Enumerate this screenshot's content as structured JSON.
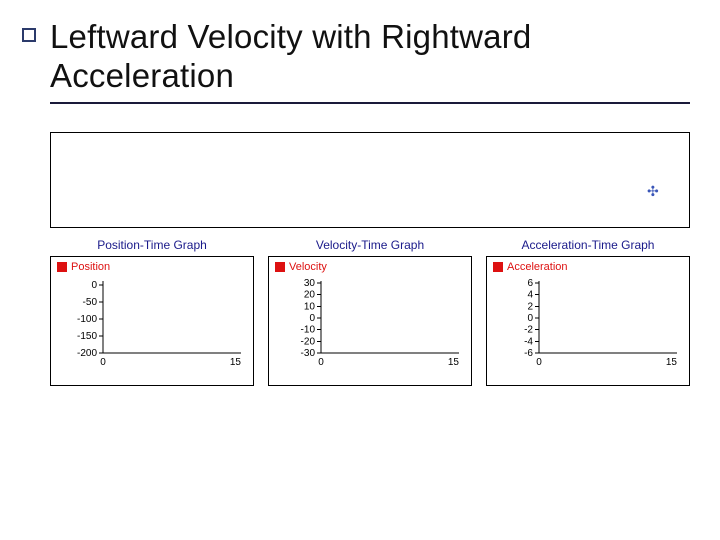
{
  "title": "Leftward Velocity with Rightward Acceleration",
  "anim_marker_glyph": "✣",
  "charts": [
    {
      "title": "Position-Time Graph",
      "legend": "Position",
      "y_ticks": [
        "0",
        "-50",
        "-100",
        "-150",
        "-200"
      ],
      "x_ticks": [
        "0",
        "15"
      ]
    },
    {
      "title": "Velocity-Time Graph",
      "legend": "Velocity",
      "y_ticks": [
        "30",
        "20",
        "10",
        "0",
        "-10",
        "-20",
        "-30"
      ],
      "x_ticks": [
        "0",
        "15"
      ]
    },
    {
      "title": "Acceleration-Time Graph",
      "legend": "Acceleration",
      "y_ticks": [
        "6",
        "4",
        "2",
        "0",
        "-2",
        "-4",
        "-6"
      ],
      "x_ticks": [
        "0",
        "15"
      ]
    }
  ],
  "chart_data": [
    {
      "type": "line",
      "title": "Position-Time Graph",
      "xlabel": "",
      "ylabel": "Position",
      "xlim": [
        0,
        15
      ],
      "ylim": [
        -200,
        0
      ],
      "x": [],
      "values": [],
      "series_name": "Position",
      "note": "empty plot area (no data curve drawn in frame)"
    },
    {
      "type": "line",
      "title": "Velocity-Time Graph",
      "xlabel": "",
      "ylabel": "Velocity",
      "xlim": [
        0,
        15
      ],
      "ylim": [
        -30,
        30
      ],
      "x": [],
      "values": [],
      "series_name": "Velocity",
      "note": "empty plot area (no data curve drawn in frame)"
    },
    {
      "type": "line",
      "title": "Acceleration-Time Graph",
      "xlabel": "",
      "ylabel": "Acceleration",
      "xlim": [
        0,
        15
      ],
      "ylim": [
        -6,
        6
      ],
      "x": [],
      "values": [],
      "series_name": "Acceleration",
      "note": "empty plot area (no data curve drawn in frame)"
    }
  ]
}
